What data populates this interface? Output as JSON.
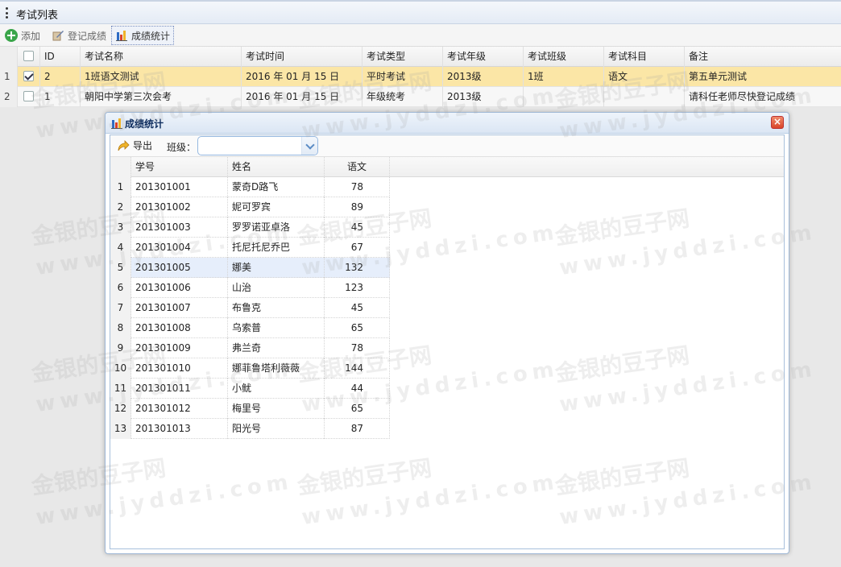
{
  "panel": {
    "title": "考试列表"
  },
  "toolbar": {
    "add_label": "添加",
    "register_label": "登记成绩",
    "stats_label": "成绩统计"
  },
  "grid": {
    "columns": [
      "ID",
      "考试名称",
      "考试时间",
      "考试类型",
      "考试年级",
      "考试班级",
      "考试科目",
      "备注"
    ],
    "rows": [
      {
        "rownum": "1",
        "checked": true,
        "id": "2",
        "name": "1班语文测试",
        "time": "2016 年 01 月 15 日",
        "type": "平时考试",
        "grade": "2013级",
        "class": "1班",
        "subject": "语文",
        "note": "第五单元测试"
      },
      {
        "rownum": "2",
        "checked": false,
        "id": "1",
        "name": "朝阳中学第三次会考",
        "time": "2016 年 01 月 15 日",
        "type": "年级统考",
        "grade": "2013级",
        "class": "",
        "subject": "",
        "note": "请科任老师尽快登记成绩"
      }
    ]
  },
  "dialog": {
    "title": "成绩统计",
    "export_label": "导出",
    "class_label": "班级：",
    "class_value": "",
    "columns": [
      "学号",
      "姓名",
      "语文"
    ],
    "rows": [
      {
        "n": "1",
        "sid": "201301001",
        "name": "蒙奇D路飞",
        "score": "78"
      },
      {
        "n": "2",
        "sid": "201301002",
        "name": "妮可罗宾",
        "score": "89"
      },
      {
        "n": "3",
        "sid": "201301003",
        "name": "罗罗诺亚卓洛",
        "score": "45"
      },
      {
        "n": "4",
        "sid": "201301004",
        "name": "托尼托尼乔巴",
        "score": "67"
      },
      {
        "n": "5",
        "sid": "201301005",
        "name": "娜美",
        "score": "132"
      },
      {
        "n": "6",
        "sid": "201301006",
        "name": "山治",
        "score": "123"
      },
      {
        "n": "7",
        "sid": "201301007",
        "name": "布鲁克",
        "score": "45"
      },
      {
        "n": "8",
        "sid": "201301008",
        "name": "乌索普",
        "score": "65"
      },
      {
        "n": "9",
        "sid": "201301009",
        "name": "弗兰奇",
        "score": "78"
      },
      {
        "n": "10",
        "sid": "201301010",
        "name": "娜菲鲁塔利薇薇",
        "score": "144"
      },
      {
        "n": "11",
        "sid": "201301011",
        "name": "小鱿",
        "score": "44"
      },
      {
        "n": "12",
        "sid": "201301012",
        "name": "梅里号",
        "score": "65"
      },
      {
        "n": "13",
        "sid": "201301013",
        "name": "阳光号",
        "score": "87"
      }
    ]
  },
  "watermark": {
    "cn": "金银的豆子网",
    "en": "www.jyddzi.com"
  },
  "colors": {
    "selected_row": "#fbe6a6",
    "hover_row": "#e6eefb",
    "dialog_border": "#9fb8d6",
    "title_text": "#0e2d5f"
  }
}
